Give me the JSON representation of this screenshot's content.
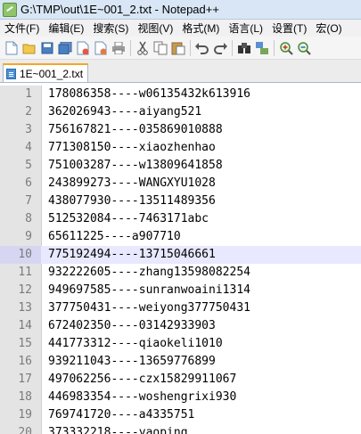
{
  "window": {
    "title": "G:\\TMP\\out\\1E~001_2.txt - Notepad++"
  },
  "menu": [
    "文件(F)",
    "编辑(E)",
    "搜索(S)",
    "视图(V)",
    "格式(M)",
    "语言(L)",
    "设置(T)",
    "宏(O)"
  ],
  "toolbar": {
    "icons": [
      "new-file-icon",
      "open-file-icon",
      "save-icon",
      "save-all-icon",
      "close-icon",
      "close-all-icon",
      "print-icon",
      "cut-icon",
      "copy-icon",
      "paste-icon",
      "undo-icon",
      "redo-icon",
      "find-icon",
      "replace-icon",
      "zoom-in-icon",
      "zoom-out-icon"
    ]
  },
  "tab": {
    "label": "1E~001_2.txt"
  },
  "editor": {
    "current_line": 10,
    "lines": [
      {
        "n": "1",
        "text": "178086358----w06135432k613916"
      },
      {
        "n": "2",
        "text": "362026943----aiyang521"
      },
      {
        "n": "3",
        "text": "756167821----035869010888"
      },
      {
        "n": "4",
        "text": "771308150----xiaozhenhao"
      },
      {
        "n": "5",
        "text": "751003287----w13809641858"
      },
      {
        "n": "6",
        "text": "243899273----WANGXYU1028"
      },
      {
        "n": "7",
        "text": "438077930----13511489356"
      },
      {
        "n": "8",
        "text": "512532084----7463171abc"
      },
      {
        "n": "9",
        "text": "65611225----a907710"
      },
      {
        "n": "10",
        "text": "775192494----13715046661"
      },
      {
        "n": "11",
        "text": "932222605----zhang13598082254"
      },
      {
        "n": "12",
        "text": "949697585----sunranwoaini1314"
      },
      {
        "n": "13",
        "text": "377750431----weiyong377750431"
      },
      {
        "n": "14",
        "text": "672402350----03142933903"
      },
      {
        "n": "15",
        "text": "441773312----qiaokeli1010"
      },
      {
        "n": "16",
        "text": "939211043----13659776899"
      },
      {
        "n": "17",
        "text": "497062256----czx15829911067"
      },
      {
        "n": "18",
        "text": "446983354----woshengrixi930"
      },
      {
        "n": "19",
        "text": "769741720----a4335751"
      },
      {
        "n": "20",
        "text": "373332218----yaoping"
      }
    ]
  }
}
